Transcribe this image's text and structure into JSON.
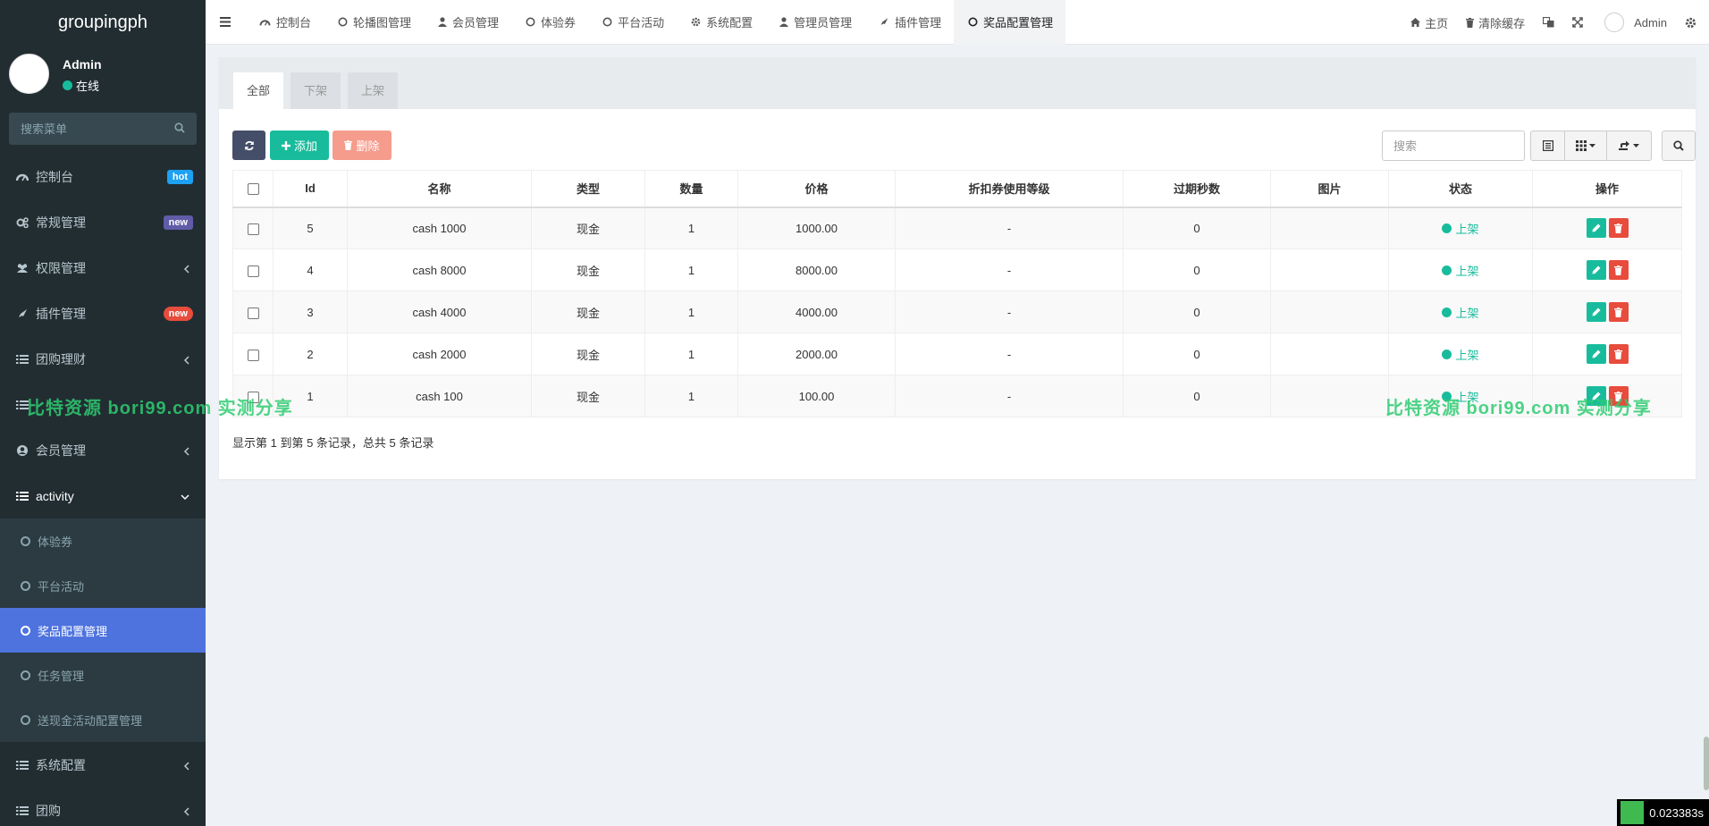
{
  "app": {
    "brand": "groupingph"
  },
  "user": {
    "name": "Admin",
    "status": "在线"
  },
  "sidebar": {
    "search_placeholder": "搜索菜单",
    "items": [
      {
        "label": "控制台",
        "badge": "hot",
        "badge_color": "#1da1f2"
      },
      {
        "label": "常规管理",
        "badge": "new",
        "badge_color": "#605ca8"
      },
      {
        "label": "权限管理"
      },
      {
        "label": "插件管理",
        "badge": "new",
        "badge_color": "#e74c3c"
      },
      {
        "label": "团购理财"
      },
      {
        "label": "会员管理"
      },
      {
        "label": "activity"
      },
      {
        "label": "系统配置"
      },
      {
        "label": "团购"
      }
    ],
    "activity_sub": [
      {
        "label": "体验券"
      },
      {
        "label": "平台活动"
      },
      {
        "label": "奖品配置管理"
      },
      {
        "label": "任务管理"
      },
      {
        "label": "送现金活动配置管理"
      }
    ]
  },
  "topnav": {
    "tabs": [
      {
        "label": "控制台"
      },
      {
        "label": "轮播图管理"
      },
      {
        "label": "会员管理"
      },
      {
        "label": "体验券"
      },
      {
        "label": "平台活动"
      },
      {
        "label": "系统配置"
      },
      {
        "label": "管理员管理"
      },
      {
        "label": "插件管理"
      },
      {
        "label": "奖品配置管理"
      }
    ],
    "home": "主页",
    "clear_cache": "清除缓存",
    "admin": "Admin"
  },
  "page": {
    "subtabs": [
      "全部",
      "下架",
      "上架"
    ],
    "toolbar": {
      "add": "添加",
      "delete": "删除",
      "search_placeholder": "搜索"
    },
    "columns": [
      "Id",
      "名称",
      "类型",
      "数量",
      "价格",
      "折扣券使用等级",
      "过期秒数",
      "图片",
      "状态",
      "操作"
    ],
    "rows": [
      {
        "id": "5",
        "name": "cash 1000",
        "type": "现金",
        "qty": "1",
        "price": "1000.00",
        "level": "-",
        "expire": "0",
        "image": "",
        "status": "上架"
      },
      {
        "id": "4",
        "name": "cash 8000",
        "type": "现金",
        "qty": "1",
        "price": "8000.00",
        "level": "-",
        "expire": "0",
        "image": "",
        "status": "上架"
      },
      {
        "id": "3",
        "name": "cash 4000",
        "type": "现金",
        "qty": "1",
        "price": "4000.00",
        "level": "-",
        "expire": "0",
        "image": "",
        "status": "上架"
      },
      {
        "id": "2",
        "name": "cash 2000",
        "type": "现金",
        "qty": "1",
        "price": "2000.00",
        "level": "-",
        "expire": "0",
        "image": "",
        "status": "上架"
      },
      {
        "id": "1",
        "name": "cash 100",
        "type": "现金",
        "qty": "1",
        "price": "100.00",
        "level": "-",
        "expire": "0",
        "image": "",
        "status": "上架"
      }
    ],
    "pager_text": "显示第 1 到第 5 条记录，总共 5 条记录"
  },
  "watermark": "比特资源 bori99.com 实测分享",
  "timer": "0.023383s",
  "colors": {
    "accent": "#4e73df",
    "success": "#18bc9c",
    "danger": "#e74c3c",
    "sidebar": "#222d32"
  }
}
